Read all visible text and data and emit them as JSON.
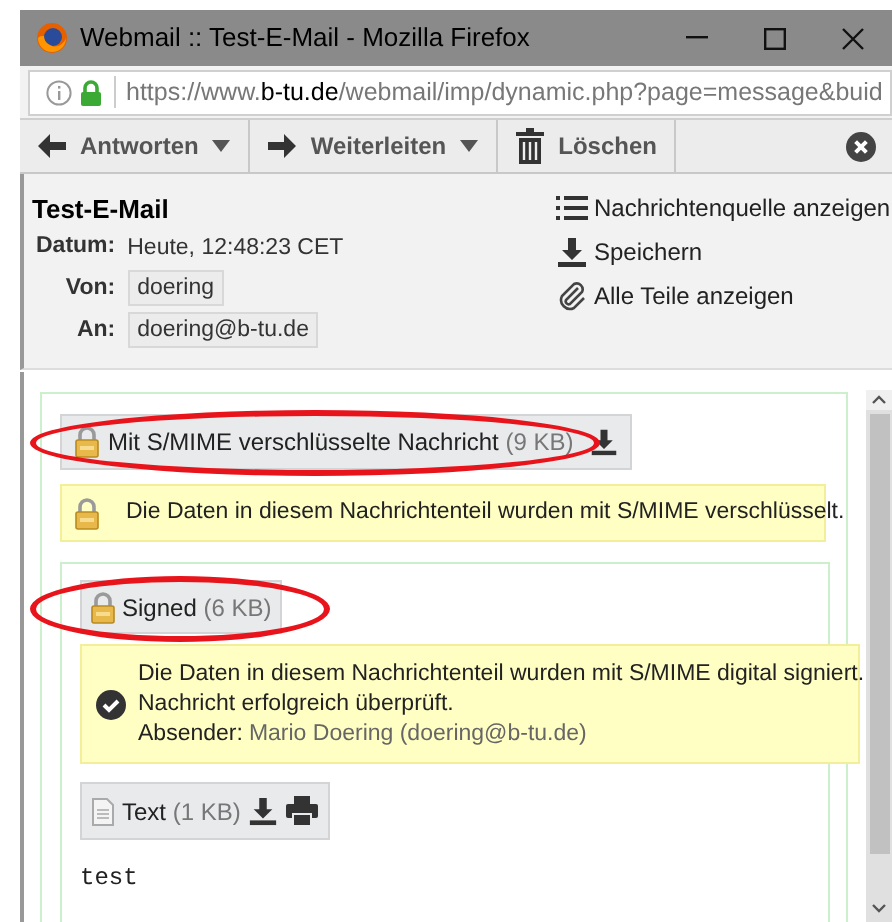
{
  "window": {
    "title": "Webmail :: Test-E-Mail - Mozilla Firefox"
  },
  "address_bar": {
    "url": "https://www.**b-tu.de**/webmail/imp/dynamic.php?page=message&buid"
  },
  "toolbar": {
    "buttons": [
      {
        "label": "Antworten",
        "kind": "reply",
        "dropdown": true
      },
      {
        "label": "Weiterleiten",
        "kind": "forward",
        "dropdown": true
      },
      {
        "label": "Löschen",
        "kind": "delete",
        "dropdown": false
      }
    ]
  },
  "message": {
    "subject": "Test-E-Mail",
    "fields": [
      {
        "label": "Datum:",
        "value": "Heute, 12:48:23 CET",
        "boxed": false
      },
      {
        "label": "Von:",
        "value": "doering",
        "boxed": true
      },
      {
        "label": "An:",
        "value": "doering@b-tu.de",
        "boxed": true
      }
    ],
    "actions": [
      {
        "label": "Nachrichtenquelle anzeigen",
        "kind": "source"
      },
      {
        "label": "Speichern",
        "kind": "save"
      },
      {
        "label": "Alle Teile anzeigen",
        "kind": "attachments"
      }
    ]
  },
  "encrypted_part": {
    "label": "Mit S/MIME verschlüsselte Nachricht",
    "size": "(9 KB)",
    "highlighted": true,
    "notice": "Die Daten in diesem Nachrichtenteil wurden mit S/MIME verschlüsselt."
  },
  "signed_part": {
    "label": "Signed",
    "size": "(6 KB)",
    "highlighted": true,
    "notice_lines": [
      "Die Daten in diesem Nachrichtenteil wurden mit S/MIME digital signiert.",
      "Nachricht erfolgreich überprüft."
    ],
    "sender_label": "Absender:",
    "sender": "Mario Doering (doering@b-tu.de)"
  },
  "text_part": {
    "label": "Text",
    "size": "(1 KB)",
    "body": "test"
  }
}
